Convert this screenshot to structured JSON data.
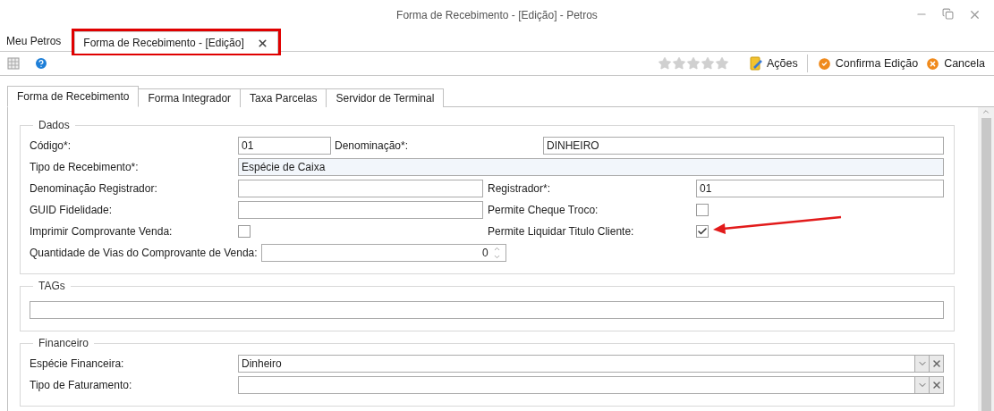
{
  "window": {
    "title": "Forma de Recebimento - [Edição] - Petros"
  },
  "document_tabs": [
    {
      "label": "Meu Petros",
      "selected": false,
      "closable": false,
      "highlighted": false
    },
    {
      "label": "Forma de Recebimento - [Edição]",
      "selected": true,
      "closable": true,
      "highlighted": true
    }
  ],
  "toolbar": {
    "stars": 0,
    "actions": [
      {
        "label": "Ações",
        "kind": "menu"
      },
      {
        "label": "Confirma Edição",
        "kind": "confirm"
      },
      {
        "label": "Cancela",
        "kind": "cancel"
      }
    ]
  },
  "tabs": [
    {
      "label": "Forma de Recebimento",
      "selected": true
    },
    {
      "label": "Forma Integrador",
      "selected": false
    },
    {
      "label": "Taxa Parcelas",
      "selected": false
    },
    {
      "label": "Servidor de Terminal",
      "selected": false
    }
  ],
  "groups": [
    {
      "title": "Dados",
      "kind": "form",
      "rows": [
        {
          "kind": "short",
          "fields": [
            {
              "label": "Código*:",
              "kind": "text",
              "value": "01"
            },
            {
              "label": "Denominação*:",
              "kind": "text",
              "value": "DINHEIRO"
            }
          ]
        },
        {
          "kind": "full",
          "fields": [
            {
              "label": "Tipo de Recebimento*:",
              "kind": "readonly",
              "value": "Espécie de Caixa"
            }
          ]
        },
        {
          "kind": "pair",
          "fields": [
            {
              "label": "Denominação Registrador:",
              "kind": "text"
            },
            {
              "label": "Registrador*:",
              "kind": "text",
              "value": "01"
            }
          ]
        },
        {
          "kind": "pair",
          "fields": [
            {
              "label": "GUID Fidelidade:",
              "kind": "text"
            },
            {
              "label": "Permite Cheque Troco:",
              "kind": "checkbox",
              "checked": false,
              "arrow": false
            }
          ]
        },
        {
          "kind": "pair",
          "fields": [
            {
              "label": "Imprimir Comprovante Venda:",
              "kind": "checkbox",
              "checked": false,
              "arrow": false
            },
            {
              "label": "Permite Liquidar Titulo Cliente:",
              "kind": "checkbox",
              "checked": true,
              "arrow": true
            }
          ]
        },
        {
          "kind": "pair",
          "fields": [
            {
              "label": "Quantidade de Vias do Comprovante de Venda:",
              "kind": "spin",
              "value": "0"
            }
          ]
        }
      ]
    },
    {
      "title": "TAGs",
      "kind": "tags"
    },
    {
      "title": "Financeiro",
      "kind": "form",
      "rows": [
        {
          "kind": "full",
          "fields": [
            {
              "label": "Espécie Financeira:",
              "kind": "combo",
              "value": "Dinheiro"
            }
          ]
        },
        {
          "kind": "full",
          "fields": [
            {
              "label": "Tipo de Faturamento:",
              "kind": "combo"
            }
          ]
        }
      ]
    }
  ]
}
